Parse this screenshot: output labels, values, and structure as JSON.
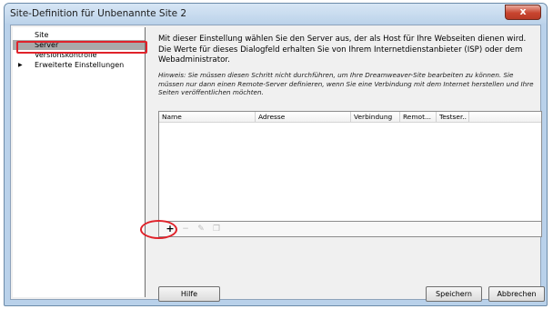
{
  "window": {
    "title": "Site-Definition für Unbenannte Site 2",
    "close_label": "x"
  },
  "sidebar": {
    "items": [
      {
        "label": "Site"
      },
      {
        "label": "Server"
      },
      {
        "label": "Versionskontrolle"
      },
      {
        "label": "Erweiterte Einstellungen"
      }
    ],
    "selected": "Server",
    "expand_glyph": "▶"
  },
  "content": {
    "description": "Mit dieser Einstellung wählen Sie den Server aus, der als Host für Ihre Webseiten dienen wird. Die Werte für dieses Dialogfeld erhalten Sie von Ihrem Internetdienstanbieter (ISP) oder dem Webadministrator.",
    "hint": "Hinweis: Sie müssen diesen Schritt nicht durchführen, um Ihre Dreamweaver-Site bearbeiten zu können. Sie müssen nur dann einen Remote-Server definieren, wenn Sie eine Verbindung mit dem Internet herstellen und Ihre Seiten veröffentlichen möchten."
  },
  "server_table": {
    "columns": [
      "Name",
      "Adresse",
      "Verbindung",
      "Remot...",
      "Testser.."
    ],
    "rows": []
  },
  "toolbar": {
    "add_glyph": "+",
    "remove_glyph": "−",
    "edit_glyph": "✎",
    "duplicate_glyph": "❐"
  },
  "buttons": {
    "help": "Hilfe",
    "save": "Speichern",
    "cancel": "Abbrechen"
  },
  "colors": {
    "highlight_red": "#e0222a",
    "selected_item_bg": "#a9a9a9",
    "window_frame": "#b9d1ea"
  }
}
